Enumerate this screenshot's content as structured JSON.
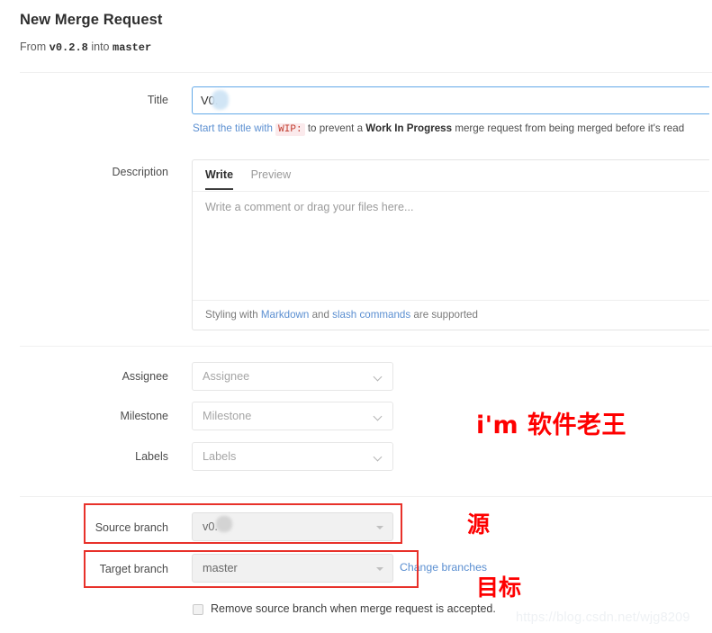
{
  "header": {
    "title": "New Merge Request",
    "from_word": "From",
    "source_branch": "v0.2.8",
    "into_word": "into",
    "target_branch": "master"
  },
  "title_field": {
    "label": "Title",
    "value": "V0.",
    "placeholder": "",
    "hint_prefix": "Start the title with",
    "hint_code": "WIP:",
    "hint_mid": "to prevent a",
    "hint_bold": "Work In Progress",
    "hint_suffix": "merge request from being merged before it's read"
  },
  "description": {
    "label": "Description",
    "tabs": [
      {
        "label": "Write",
        "active": true
      },
      {
        "label": "Preview",
        "active": false
      }
    ],
    "placeholder": "Write a comment or drag your files here...",
    "value": "",
    "footer_prefix": "Styling with",
    "footer_link1": "Markdown",
    "footer_and": "and",
    "footer_link2": "slash commands",
    "footer_suffix": "are supported"
  },
  "selects": [
    {
      "label": "Assignee",
      "value": "Assignee",
      "icon": "chevron-down-icon"
    },
    {
      "label": "Milestone",
      "value": "Milestone",
      "icon": "chevron-down-icon"
    },
    {
      "label": "Labels",
      "value": "Labels",
      "icon": "chevron-down-icon"
    }
  ],
  "branches": {
    "source": {
      "label": "Source branch",
      "value": "v0."
    },
    "target": {
      "label": "Target branch",
      "value": "master"
    },
    "change_link": "Change branches"
  },
  "remove_branch": {
    "label": "Remove source branch when merge request is accepted.",
    "checked": false
  },
  "annotations": {
    "brand": "i'm 软件老王",
    "source": "源",
    "target": "目标",
    "color": "#fe0000"
  },
  "watermark": "https://blog.csdn.net/wjg8209",
  "colors": {
    "focus_border": "#63a9e8",
    "link": "#5b8fd1",
    "annotation_red": "#e8312a",
    "code_bg": "#fbeaec",
    "code_text": "#c0392b"
  }
}
